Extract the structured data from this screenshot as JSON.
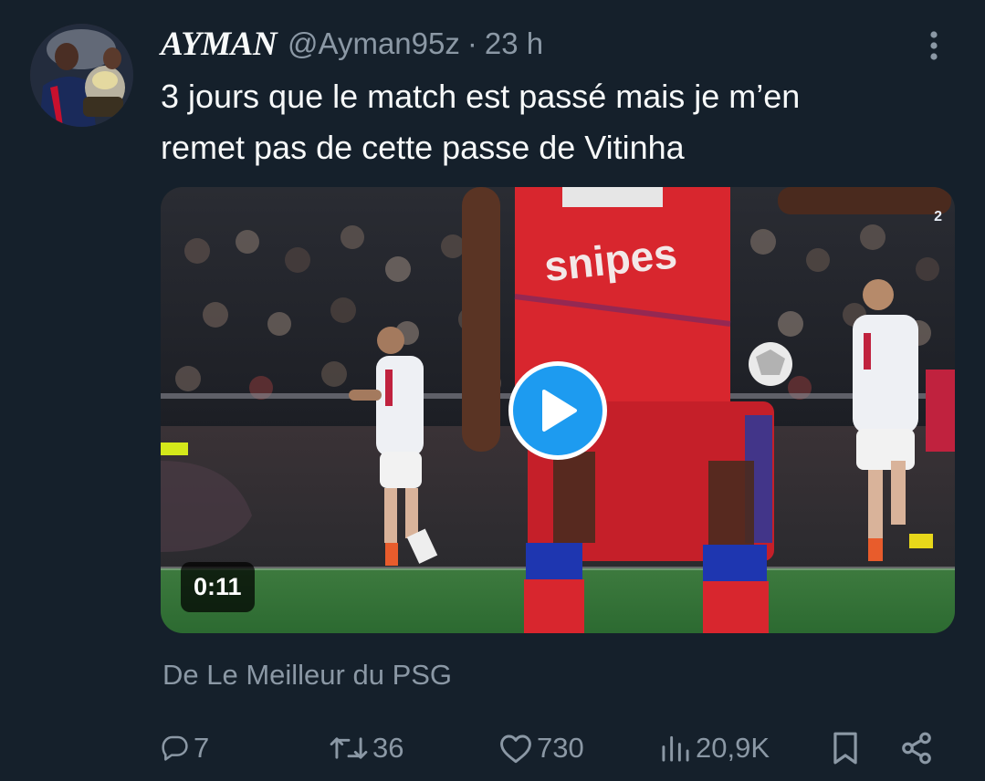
{
  "author": {
    "display_name": "AYMAN",
    "handle": "@Ayman95z",
    "separator": "·",
    "timestamp": "23 h",
    "avatar_icon": "profile-photo"
  },
  "tweet": {
    "text_lines": [
      "3 jours que le match est passé mais je m’en",
      "remet pas de cette passe de Vitinha"
    ]
  },
  "video": {
    "duration": "0:11",
    "jersey_sponsor": "snipes",
    "channel_badge": "2"
  },
  "source": "De Le Meilleur du PSG",
  "actions": {
    "replies": "7",
    "reposts": "36",
    "likes": "730",
    "views": "20,9K"
  },
  "colors": {
    "background": "#15202b",
    "primary_text": "#f7f9f9",
    "secondary_text": "#8b98a5",
    "accent": "#1d9bf0"
  },
  "icons": {
    "more": "more-vertical-icon",
    "reply": "reply-icon",
    "repost": "repost-icon",
    "like": "heart-icon",
    "views": "views-icon",
    "bookmark": "bookmark-icon",
    "share": "share-icon",
    "play": "play-icon"
  }
}
